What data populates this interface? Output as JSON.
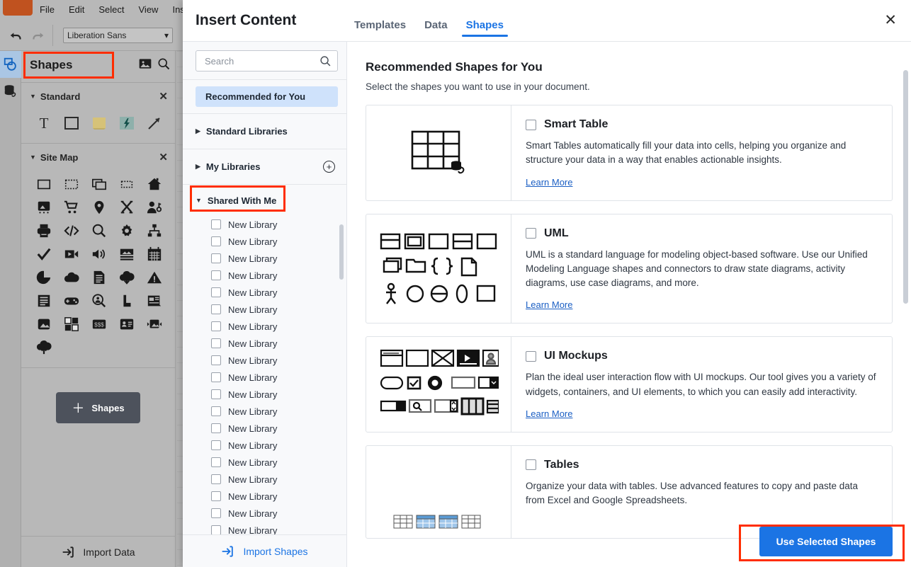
{
  "app": {
    "menu": [
      "File",
      "Edit",
      "Select",
      "View",
      "Insert"
    ],
    "toolbar": {
      "font_value": "Liberation Sans",
      "undo_icon": "undo-icon",
      "redo_icon": "redo-icon",
      "dropdown_icon": "chevron-down-icon"
    },
    "panel": {
      "title": "Shapes",
      "image_icon": "image-icon",
      "search_icon": "search-icon",
      "sections": [
        {
          "title": "Standard",
          "close_icon": "close-icon",
          "icons": [
            "text-icon",
            "rectangle-icon",
            "sticky-note-icon",
            "lightning-icon",
            "arrow-icon"
          ]
        },
        {
          "title": "Site Map",
          "close_icon": "close-icon",
          "icons": [
            "page-icon",
            "dashed-page-icon",
            "pages-icon",
            "dashed-box-icon",
            "home-icon",
            "image-page-icon",
            "cart-icon",
            "location-pin-icon",
            "crossroad-icon",
            "user-key-icon",
            "printer-icon",
            "code-icon",
            "search-icon",
            "gear-icon",
            "sitemap-icon",
            "check-icon",
            "video-icon",
            "audio-icon",
            "gallery-icon",
            "calendar-icon",
            "pie-chart-icon",
            "cloud-icon",
            "document-icon",
            "cloud-download-icon",
            "warning-icon",
            "article-icon",
            "gamepad-icon",
            "search-user-icon",
            "chart-icon",
            "news-icon",
            "image-icon",
            "layout-icon",
            "money-icon",
            "id-card-icon",
            "slideshow-icon",
            "cloud-upload-icon"
          ]
        }
      ],
      "add_shapes_label": "Shapes",
      "add_icon": "plus-icon",
      "import_data_label": "Import Data",
      "import_data_icon": "import-icon"
    }
  },
  "modal": {
    "title": "Insert Content",
    "close_icon": "close-icon",
    "tabs": [
      {
        "label": "Templates",
        "active": false
      },
      {
        "label": "Data",
        "active": false
      },
      {
        "label": "Shapes",
        "active": true
      }
    ],
    "sidebar": {
      "search": {
        "placeholder": "Search",
        "value": "",
        "icon": "search-icon"
      },
      "recommended_chip": "Recommended for You",
      "sections": [
        {
          "label": "Standard Libraries",
          "expanded": false,
          "has_add": false
        },
        {
          "label": "My Libraries",
          "expanded": false,
          "has_add": true,
          "add_icon": "plus-circle-icon"
        },
        {
          "label": "Shared With Me",
          "expanded": true,
          "has_add": false,
          "highlighted": true
        }
      ],
      "libraries": [
        "New Library",
        "New Library",
        "New Library",
        "New Library",
        "New Library",
        "New Library",
        "New Library",
        "New Library",
        "New Library",
        "New Library",
        "New Library",
        "New Library",
        "New Library",
        "New Library",
        "New Library",
        "New Library",
        "New Library",
        "New Library",
        "New Library"
      ],
      "import_shapes_label": "Import Shapes",
      "import_shapes_icon": "import-icon"
    },
    "content": {
      "heading": "Recommended Shapes for You",
      "subheading": "Select the shapes you want to use in your document.",
      "learn_more_label": "Learn More",
      "cards": [
        {
          "name": "Smart Table",
          "checked": false,
          "description": "Smart Tables automatically fill your data into cells, helping you organize and structure your data in a way that enables actionable insights.",
          "icon": "smart-table-icon"
        },
        {
          "name": "UML",
          "checked": false,
          "description": "UML is a standard language for modeling object-based software. Use our Unified Modeling Language shapes and connectors to draw state diagrams, activity diagrams, use case diagrams, and more.",
          "icon": "uml-shapes-icon"
        },
        {
          "name": "UI Mockups",
          "checked": false,
          "description": "Plan the ideal user interaction flow with UI mockups. Our tool gives you a variety of widgets, containers, and UI elements, to which you can easily add interactivity.",
          "icon": "ui-mockups-icon"
        },
        {
          "name": "Tables",
          "checked": false,
          "description": "Organize your data with tables. Use advanced features to copy and paste data from Excel and Google Spreadsheets.",
          "icon": "tables-icon"
        }
      ]
    },
    "footer": {
      "primary_button": "Use Selected Shapes"
    }
  },
  "colors": {
    "accent": "#1b74e4",
    "highlight_outline": "#ff2d00",
    "app_chrome": "#b8b8b8",
    "chip_bg": "#cfe2fb",
    "link": "#1b5fc4"
  }
}
